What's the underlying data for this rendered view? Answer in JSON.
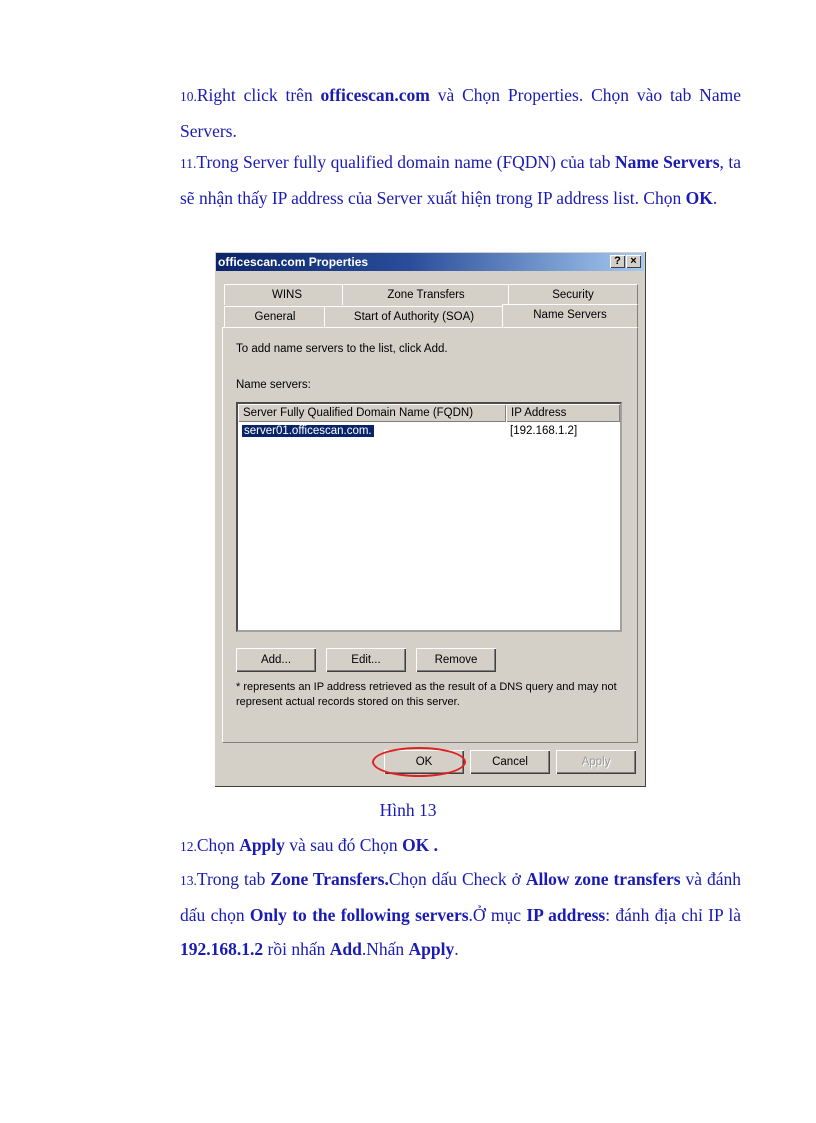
{
  "steps": {
    "s10": {
      "num": "10.",
      "t1": "Right click trên ",
      "b1": "officescan.com",
      "t2": " và Chọn Properties. Chọn vào tab Name Servers."
    },
    "s11": {
      "num": "11.",
      "t1": "Trong Server fully qualified domain name (FQDN) của tab ",
      "b1": "Name Servers",
      "t2": ", ta sẽ nhận thấy IP address của Server xuất hiện trong IP address list. Chọn ",
      "b2": "OK",
      "t3": "."
    },
    "s12": {
      "num": "12.",
      "t1": "Chọn ",
      "b1": "Apply",
      "t2": " và sau đó Chọn ",
      "b2": "OK .",
      "t3": ""
    },
    "s13": {
      "num": "13.",
      "t1": "Trong tab ",
      "b1": "Zone Transfers.",
      "t2": "Chọn dấu Check ở ",
      "b2": "Allow zone transfers",
      "t3": " và đánh dấu chọn ",
      "b3": "Only to the following servers",
      "t4": ".Ở mục ",
      "b4": "IP address",
      "t5": ": đánh địa chỉ IP là ",
      "b5": "192.168.1.2",
      "t6": " rồi nhấn ",
      "b6": "Add",
      "t7": ".Nhấn ",
      "b7": "Apply",
      "t8": "."
    }
  },
  "caption": "Hình 13",
  "dialog": {
    "title": "officescan.com Properties",
    "help_btn": "?",
    "close_btn": "×",
    "tabs_row1": [
      "WINS",
      "Zone Transfers",
      "Security"
    ],
    "tabs_row2": [
      "General",
      "Start of Authority (SOA)",
      "Name Servers"
    ],
    "intro": "To add name servers to the list, click Add.",
    "list_label": "Name servers:",
    "columns": [
      "Server Fully Qualified Domain Name (FQDN)",
      "IP Address"
    ],
    "rows": [
      {
        "fqdn": "server01.officescan.com.",
        "ip": "[192.168.1.2]"
      }
    ],
    "buttons": {
      "add": "Add...",
      "edit": "Edit...",
      "remove": "Remove"
    },
    "note": "* represents an IP address retrieved as the result of a DNS query and may not represent actual records stored on this server.",
    "footer": {
      "ok": "OK",
      "cancel": "Cancel",
      "apply": "Apply"
    }
  }
}
